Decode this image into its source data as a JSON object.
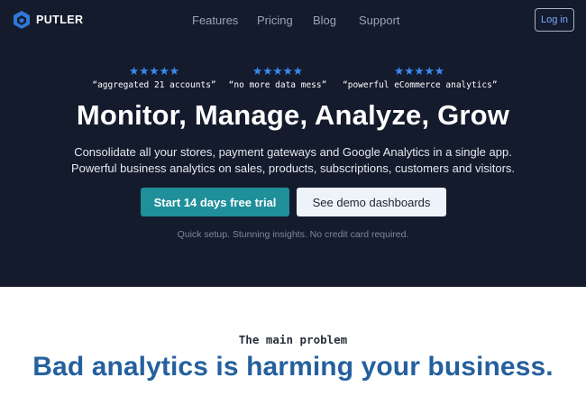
{
  "nav": {
    "brand": "PUTLER",
    "links": [
      "Features",
      "Pricing",
      "Blog",
      "Support"
    ],
    "login_label": "Log in"
  },
  "hero": {
    "reviews": [
      {
        "stars": "★★★★★",
        "quote": "“aggregated 21 accounts”"
      },
      {
        "stars": "★★★★★",
        "quote": "“no more data mess”"
      },
      {
        "stars": "★★★★★",
        "quote": "“powerful eCommerce analytics”"
      }
    ],
    "headline": "Monitor, Manage, Analyze, Grow",
    "subtitle_line1": "Consolidate all your stores, payment gateways and Google Analytics in a single app.",
    "subtitle_line2": "Powerful business analytics on sales, products, subscriptions, customers and visitors.",
    "primary_cta": "Start 14 days free trial",
    "secondary_cta": "See demo dashboards",
    "note": "Quick setup. Stunning insights. No credit card required."
  },
  "problem": {
    "kicker": "The main problem",
    "title": "Bad analytics is harming your business."
  },
  "colors": {
    "hero_bg": "#141b2d",
    "accent_teal": "#1f8f9a",
    "star_blue": "#3a8bf0",
    "title_blue": "#25609e"
  }
}
